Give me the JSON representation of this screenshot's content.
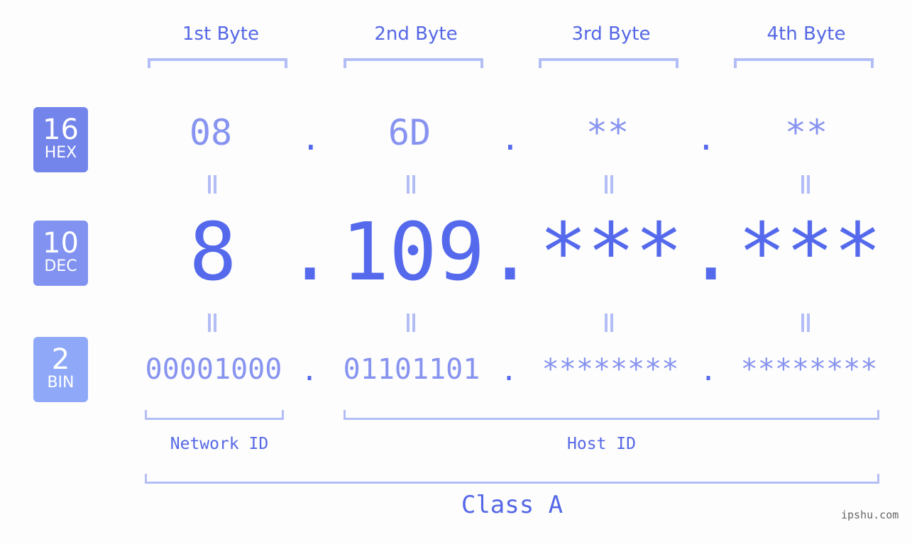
{
  "bytes": {
    "labels": [
      "1st Byte",
      "2nd Byte",
      "3rd Byte",
      "4th Byte"
    ]
  },
  "badges": {
    "hex": {
      "num": "16",
      "unit": "HEX",
      "color": "#7384eb"
    },
    "dec": {
      "num": "10",
      "unit": "DEC",
      "color": "#8192f0"
    },
    "bin": {
      "num": "2",
      "unit": "BIN",
      "color": "#8fa9f8"
    }
  },
  "hex_values": [
    "08",
    "6D",
    "**",
    "**"
  ],
  "dec_values": [
    "8",
    "109",
    "***",
    "***"
  ],
  "bin_values": [
    "00001000",
    "01101101",
    "********",
    "********"
  ],
  "separator": ".",
  "equals": "=",
  "ids": {
    "network": "Network ID",
    "host": "Host ID"
  },
  "class_label": "Class A",
  "footer": "ipshu.com",
  "colors": {
    "accent": "#5567e6",
    "light_value": "#8793f0",
    "bracket": "#b3bef7"
  }
}
